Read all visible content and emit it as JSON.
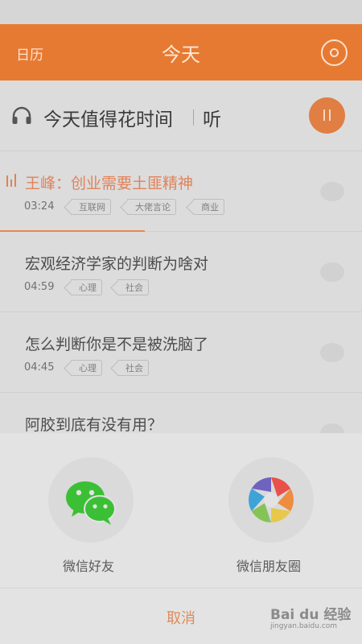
{
  "header": {
    "left": "日历",
    "title": "今天"
  },
  "listen": {
    "title": "今天值得花时间",
    "subtitle": "听"
  },
  "playlist": [
    {
      "title": "王峰：创业需要土匪精神",
      "duration": "03:24",
      "tags": [
        "互联网",
        "大佬言论",
        "商业"
      ],
      "playing": true,
      "progress": 0.4
    },
    {
      "title": "宏观经济学家的判断为啥对",
      "duration": "04:59",
      "tags": [
        "心理",
        "社会"
      ],
      "playing": false
    },
    {
      "title": "怎么判断你是不是被洗脑了",
      "duration": "04:45",
      "tags": [
        "心理",
        "社会"
      ],
      "playing": false
    },
    {
      "title": "阿胶到底有没有用？",
      "duration": "",
      "tags": [],
      "playing": false
    }
  ],
  "share": {
    "wechat_label": "微信好友",
    "moments_label": "微信朋友圈",
    "cancel_label": "取消"
  },
  "watermark": {
    "brand": "Bai du 经验",
    "url": "jingyan.baidu.com"
  },
  "colors": {
    "accent": "#e77a33",
    "wechat_green": "#3bbf35"
  }
}
